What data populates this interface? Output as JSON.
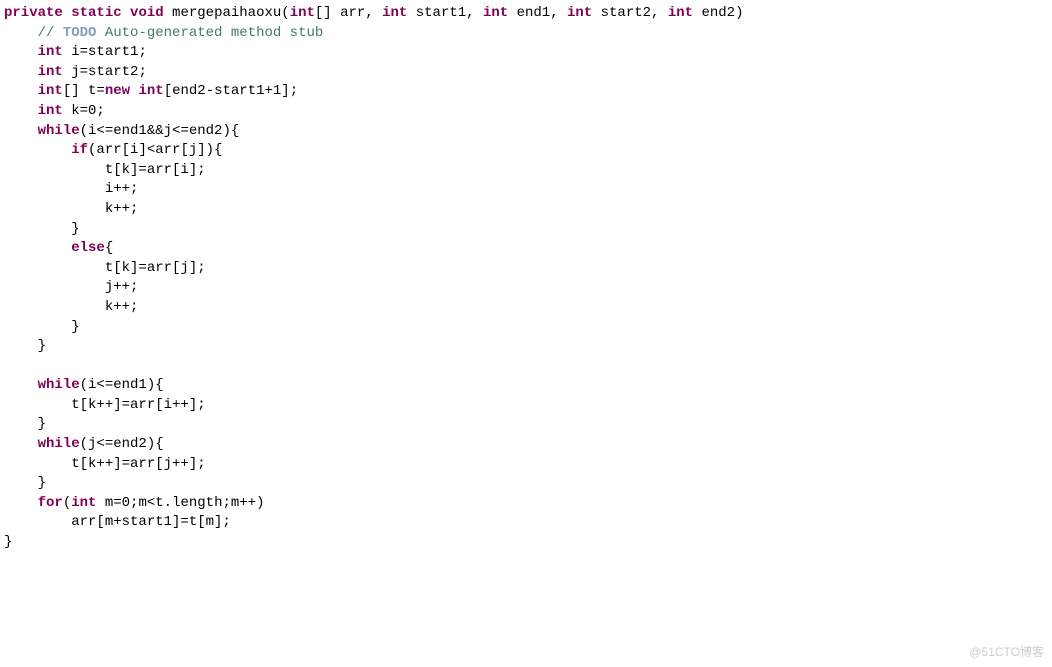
{
  "code": {
    "l1_kw1": "private",
    "l1_kw2": "static",
    "l1_kw3": "void",
    "l1_fn": " mergepaihaoxu(",
    "l1_kw4": "int",
    "l1_p1": "[] arr, ",
    "l1_kw5": "int",
    "l1_p2": " start1, ",
    "l1_kw6": "int",
    "l1_p3": " end1, ",
    "l1_kw7": "int",
    "l1_p4": " start2, ",
    "l1_kw8": "int",
    "l1_p5": " end2)",
    "l2_cmt_pre": "    ",
    "l2_cmt1": "// ",
    "l2_todo": "TODO",
    "l2_cmt2": " Auto-generated method stub",
    "l3_pre": "    ",
    "l3_kw": "int",
    "l3_txt": " i=start1;",
    "l4_pre": "    ",
    "l4_kw": "int",
    "l4_txt": " j=start2;",
    "l5_pre": "    ",
    "l5_kw1": "int",
    "l5_txt1": "[] t=",
    "l5_kw2": "new",
    "l5_txt2": " ",
    "l5_kw3": "int",
    "l5_txt3": "[end2-start1+1];",
    "l6_pre": "    ",
    "l6_kw": "int",
    "l6_txt": " k=0;",
    "l7_pre": "    ",
    "l7_kw": "while",
    "l7_txt": "(i<=end1&&j<=end2){",
    "l8_pre": "        ",
    "l8_kw": "if",
    "l8_txt": "(arr[i]<arr[j]){",
    "l9": "            t[k]=arr[i];",
    "l10": "            i++;",
    "l11": "            k++;",
    "l12": "        }",
    "l13_pre": "        ",
    "l13_kw": "else",
    "l13_txt": "{",
    "l14": "            t[k]=arr[j];",
    "l15": "            j++;",
    "l16": "            k++;",
    "l17": "        }",
    "l18": "    }",
    "l19": "",
    "l20_pre": "    ",
    "l20_kw": "while",
    "l20_txt": "(i<=end1){",
    "l21": "        t[k++]=arr[i++];",
    "l22": "    }",
    "l23_pre": "    ",
    "l23_kw": "while",
    "l23_txt": "(j<=end2){",
    "l24": "        t[k++]=arr[j++];",
    "l25": "    }",
    "l26_pre": "    ",
    "l26_kw1": "for",
    "l26_txt1": "(",
    "l26_kw2": "int",
    "l26_txt2": " m=0;m<t.length;m++)",
    "l27": "        arr[m+start1]=t[m];",
    "l28": "}"
  },
  "watermark": "@51CTO博客"
}
